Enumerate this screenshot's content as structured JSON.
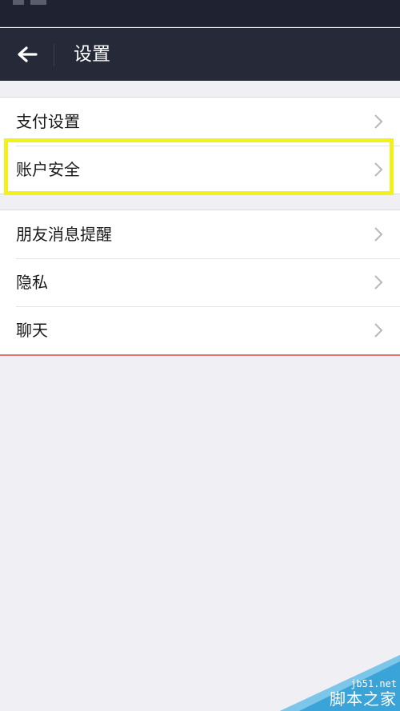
{
  "nav": {
    "title": "设置",
    "back_icon": "arrow-left-icon"
  },
  "groups": [
    {
      "items": [
        {
          "label": "支付设置",
          "icon": "chevron-right-icon"
        },
        {
          "label": "账户安全",
          "icon": "chevron-right-icon"
        }
      ]
    },
    {
      "items": [
        {
          "label": "朋友消息提醒",
          "icon": "chevron-right-icon"
        },
        {
          "label": "隐私",
          "icon": "chevron-right-icon"
        },
        {
          "label": "聊天",
          "icon": "chevron-right-icon"
        }
      ]
    }
  ],
  "watermark": {
    "domain": "jb51.net",
    "name": "脚本之家"
  },
  "colors": {
    "nav_background": "#262a38",
    "page_background": "#efeff4",
    "highlight": "#f2f21a",
    "bottom_divider": "#e27a74",
    "watermark_blue": "#3aa3d8"
  }
}
